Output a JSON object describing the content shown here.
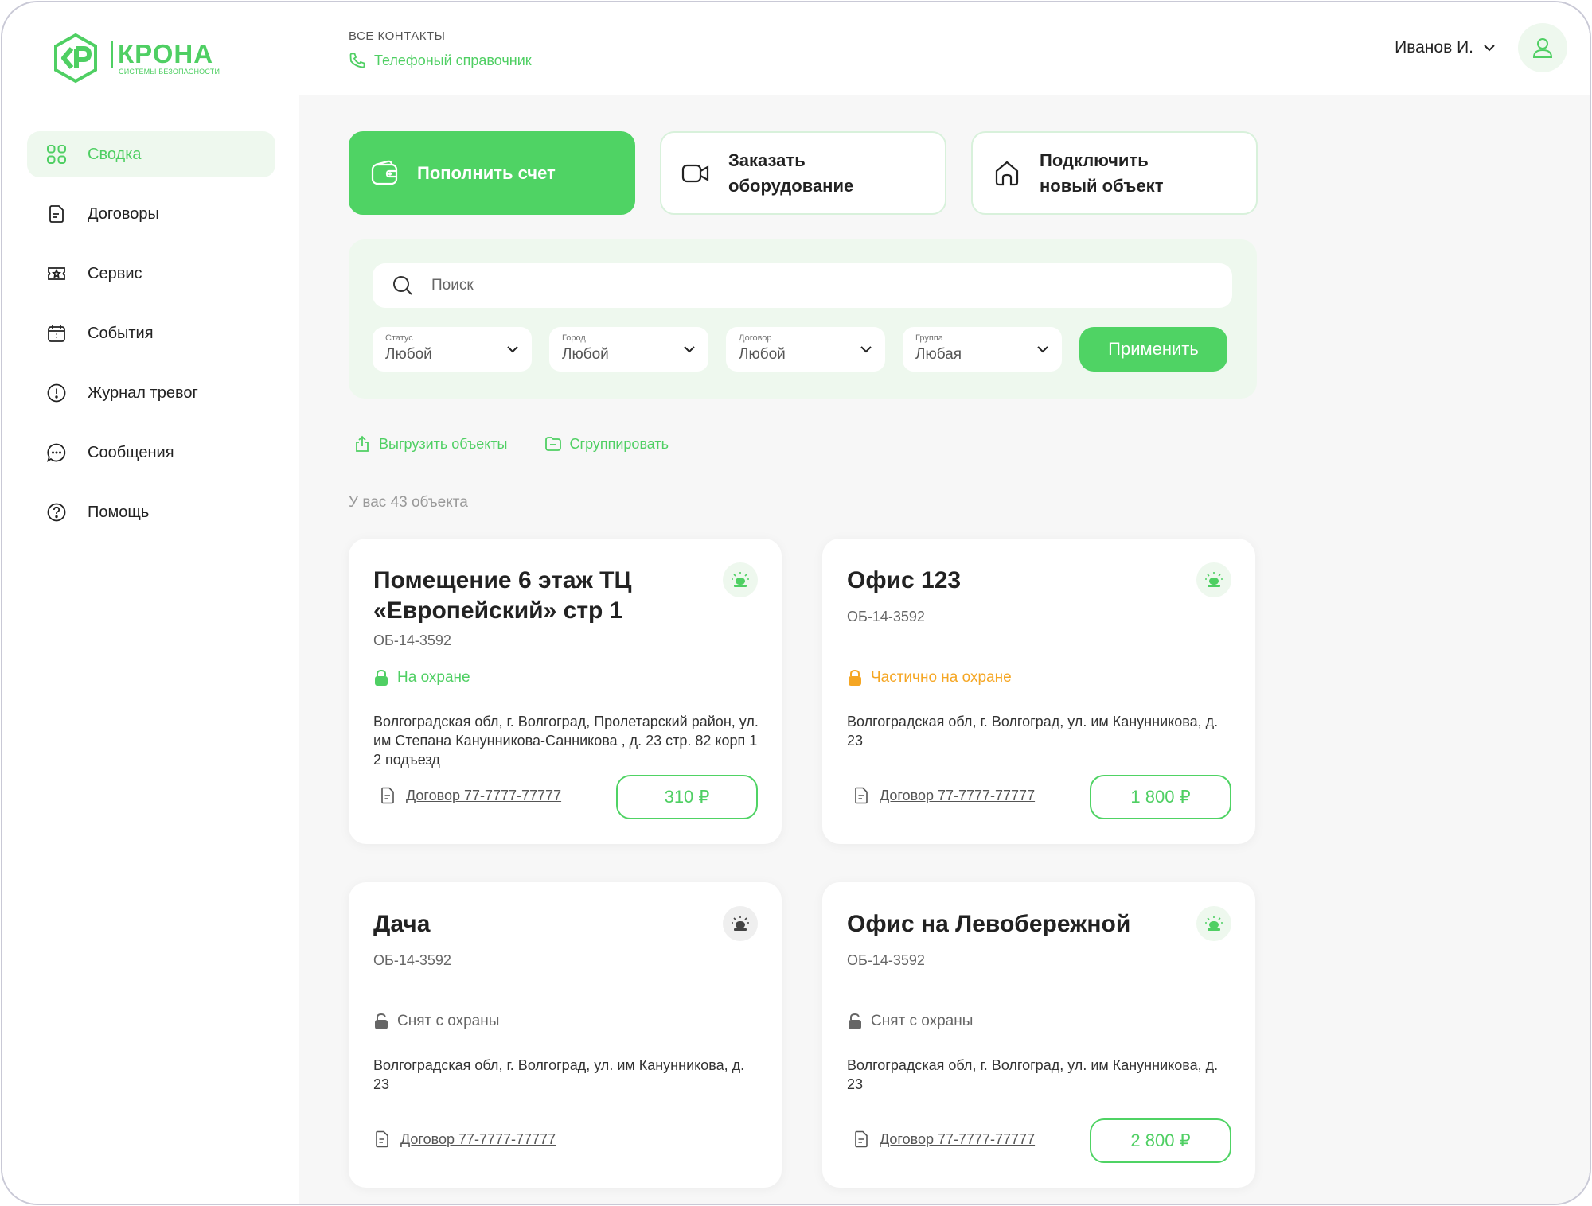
{
  "brand": {
    "name": "КРОНА",
    "tagline": "СИСТЕМЫ БЕЗОПАСНОСТИ",
    "color": "#4fcf63"
  },
  "sidebar": {
    "items": [
      {
        "label": "Сводка",
        "icon": "grid-icon",
        "active": true
      },
      {
        "label": "Договоры",
        "icon": "document-icon",
        "active": false
      },
      {
        "label": "Сервис",
        "icon": "service-icon",
        "active": false
      },
      {
        "label": "События",
        "icon": "calendar-icon",
        "active": false
      },
      {
        "label": "Журнал тревог",
        "icon": "alert-circle-icon",
        "active": false
      },
      {
        "label": "Сообщения",
        "icon": "chat-icon",
        "active": false
      },
      {
        "label": "Помощь",
        "icon": "help-icon",
        "active": false
      }
    ]
  },
  "header": {
    "breadcrumb": "ВСЕ КОНТАКТЫ",
    "link": "Телефоный справочник",
    "user_name": "Иванов И."
  },
  "actions": [
    {
      "label": "Пополнить счет",
      "icon": "wallet-icon"
    },
    {
      "label": "Заказать оборудование",
      "icon": "camera-icon"
    },
    {
      "label": "Подключить новый объект",
      "icon": "home-icon"
    }
  ],
  "filters": {
    "search_placeholder": "Поиск",
    "status": {
      "caption": "Статус",
      "value": "Любой"
    },
    "city": {
      "caption": "Город",
      "value": "Любой"
    },
    "contract": {
      "caption": "Договор",
      "value": "Любой"
    },
    "group": {
      "caption": "Группа",
      "value": "Любая"
    },
    "apply": "Применить"
  },
  "tools": {
    "export": "Выгрузить объекты",
    "group": "Сгруппировать"
  },
  "objects_count": "У вас 43 объекта",
  "cards": [
    {
      "title": "Помещение 6 этаж ТЦ «Европейский» стр 1",
      "code": "ОБ-14-3592",
      "status": "На охране",
      "address": "Волгоградская обл, г. Волгоград, Пролетарский район, ул. им Степана Канунникова-Санникова , д. 23 стр. 82 корп 1 2 подъезд",
      "contract": "Договор 77-7777-77777",
      "price": "310 ₽"
    },
    {
      "title": "Офис 123",
      "code": "ОБ-14-3592",
      "status": "Частично на охране",
      "address": "Волгоградская обл, г. Волгоград, ул. им Канунникова, д. 23",
      "contract": "Договор 77-7777-77777",
      "price": "1 800 ₽"
    },
    {
      "title": "Дача",
      "code": "ОБ-14-3592",
      "status": "Снят с охраны",
      "address": "Волгоградская обл, г. Волгоград, ул. им Канунникова, д. 23",
      "contract": "Договор 77-7777-77777",
      "price": ""
    },
    {
      "title": "Офис на Левобережной",
      "code": "ОБ-14-3592",
      "status": "Снят с охраны",
      "address": "Волгоградская обл, г. Волгоград, ул. им Канунникова, д. 23",
      "contract": "Договор 77-7777-77777",
      "price": "2 800 ₽"
    }
  ],
  "colors": {
    "accent": "#4fd364",
    "warning": "#f5a623",
    "muted": "#666666",
    "panel": "#eef8ee"
  }
}
